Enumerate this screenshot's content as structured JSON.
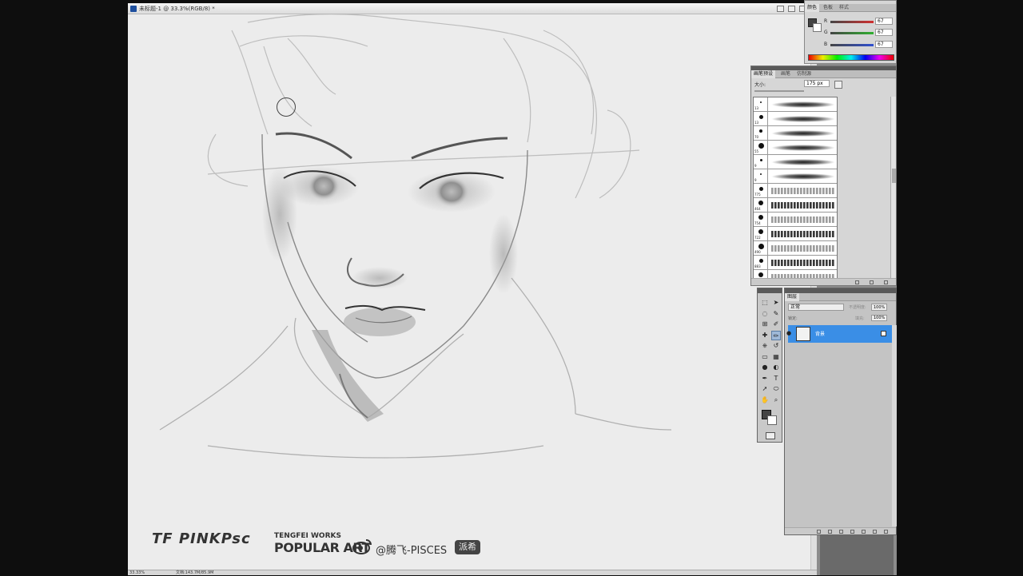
{
  "document": {
    "title": "未标题-1 @ 33.3%(RGB/8) *",
    "zoom": "33.33%",
    "doc_info": "文档:143.7M/85.9M"
  },
  "color_panel": {
    "tabs": [
      "颜色",
      "色板",
      "样式"
    ],
    "channels": [
      {
        "label": "R",
        "value": "67",
        "color": "#d03030"
      },
      {
        "label": "G",
        "value": "67",
        "color": "#30b030"
      },
      {
        "label": "B",
        "value": "67",
        "color": "#3050d0"
      }
    ],
    "foreground": "#434343",
    "background": "#ffffff"
  },
  "brush_panel": {
    "tabs": [
      "画笔预设",
      "画笔",
      "仿制源"
    ],
    "size_label": "大小:",
    "size_value": "175 px",
    "brushes": [
      {
        "size": "13"
      },
      {
        "size": "13"
      },
      {
        "size": "70"
      },
      {
        "size": "55"
      },
      {
        "size": "9"
      },
      {
        "size": "9"
      },
      {
        "size": "775"
      },
      {
        "size": "464"
      },
      {
        "size": "754"
      },
      {
        "size": "722"
      },
      {
        "size": "490"
      },
      {
        "size": "883"
      },
      {
        "size": "675"
      }
    ]
  },
  "layers_panel": {
    "tabs": [
      "图层"
    ],
    "blend_mode": "正常",
    "opacity_label": "不透明度:",
    "opacity": "100%",
    "lock_label": "锁定:",
    "fill_label": "填充:",
    "fill": "100%",
    "layers": [
      {
        "name": "背景",
        "selected": true
      }
    ]
  },
  "toolbox": {
    "tools": [
      "marquee-tool",
      "move-tool",
      "lasso-tool",
      "quick-select-tool",
      "crop-tool",
      "eyedropper-tool",
      "healing-tool",
      "brush-tool",
      "clone-stamp-tool",
      "history-brush-tool",
      "eraser-tool",
      "gradient-tool",
      "blur-tool",
      "dodge-tool",
      "pen-tool",
      "type-tool",
      "path-select-tool",
      "shape-tool",
      "hand-tool",
      "zoom-tool"
    ],
    "type_glyph": "T"
  },
  "watermark": {
    "signature": "TF PINKPsc",
    "studio": "TENGFEI WORKS",
    "brand": "POPULAR ART",
    "weibo_handle": "@腾飞-PISCES",
    "badge": "派希"
  }
}
